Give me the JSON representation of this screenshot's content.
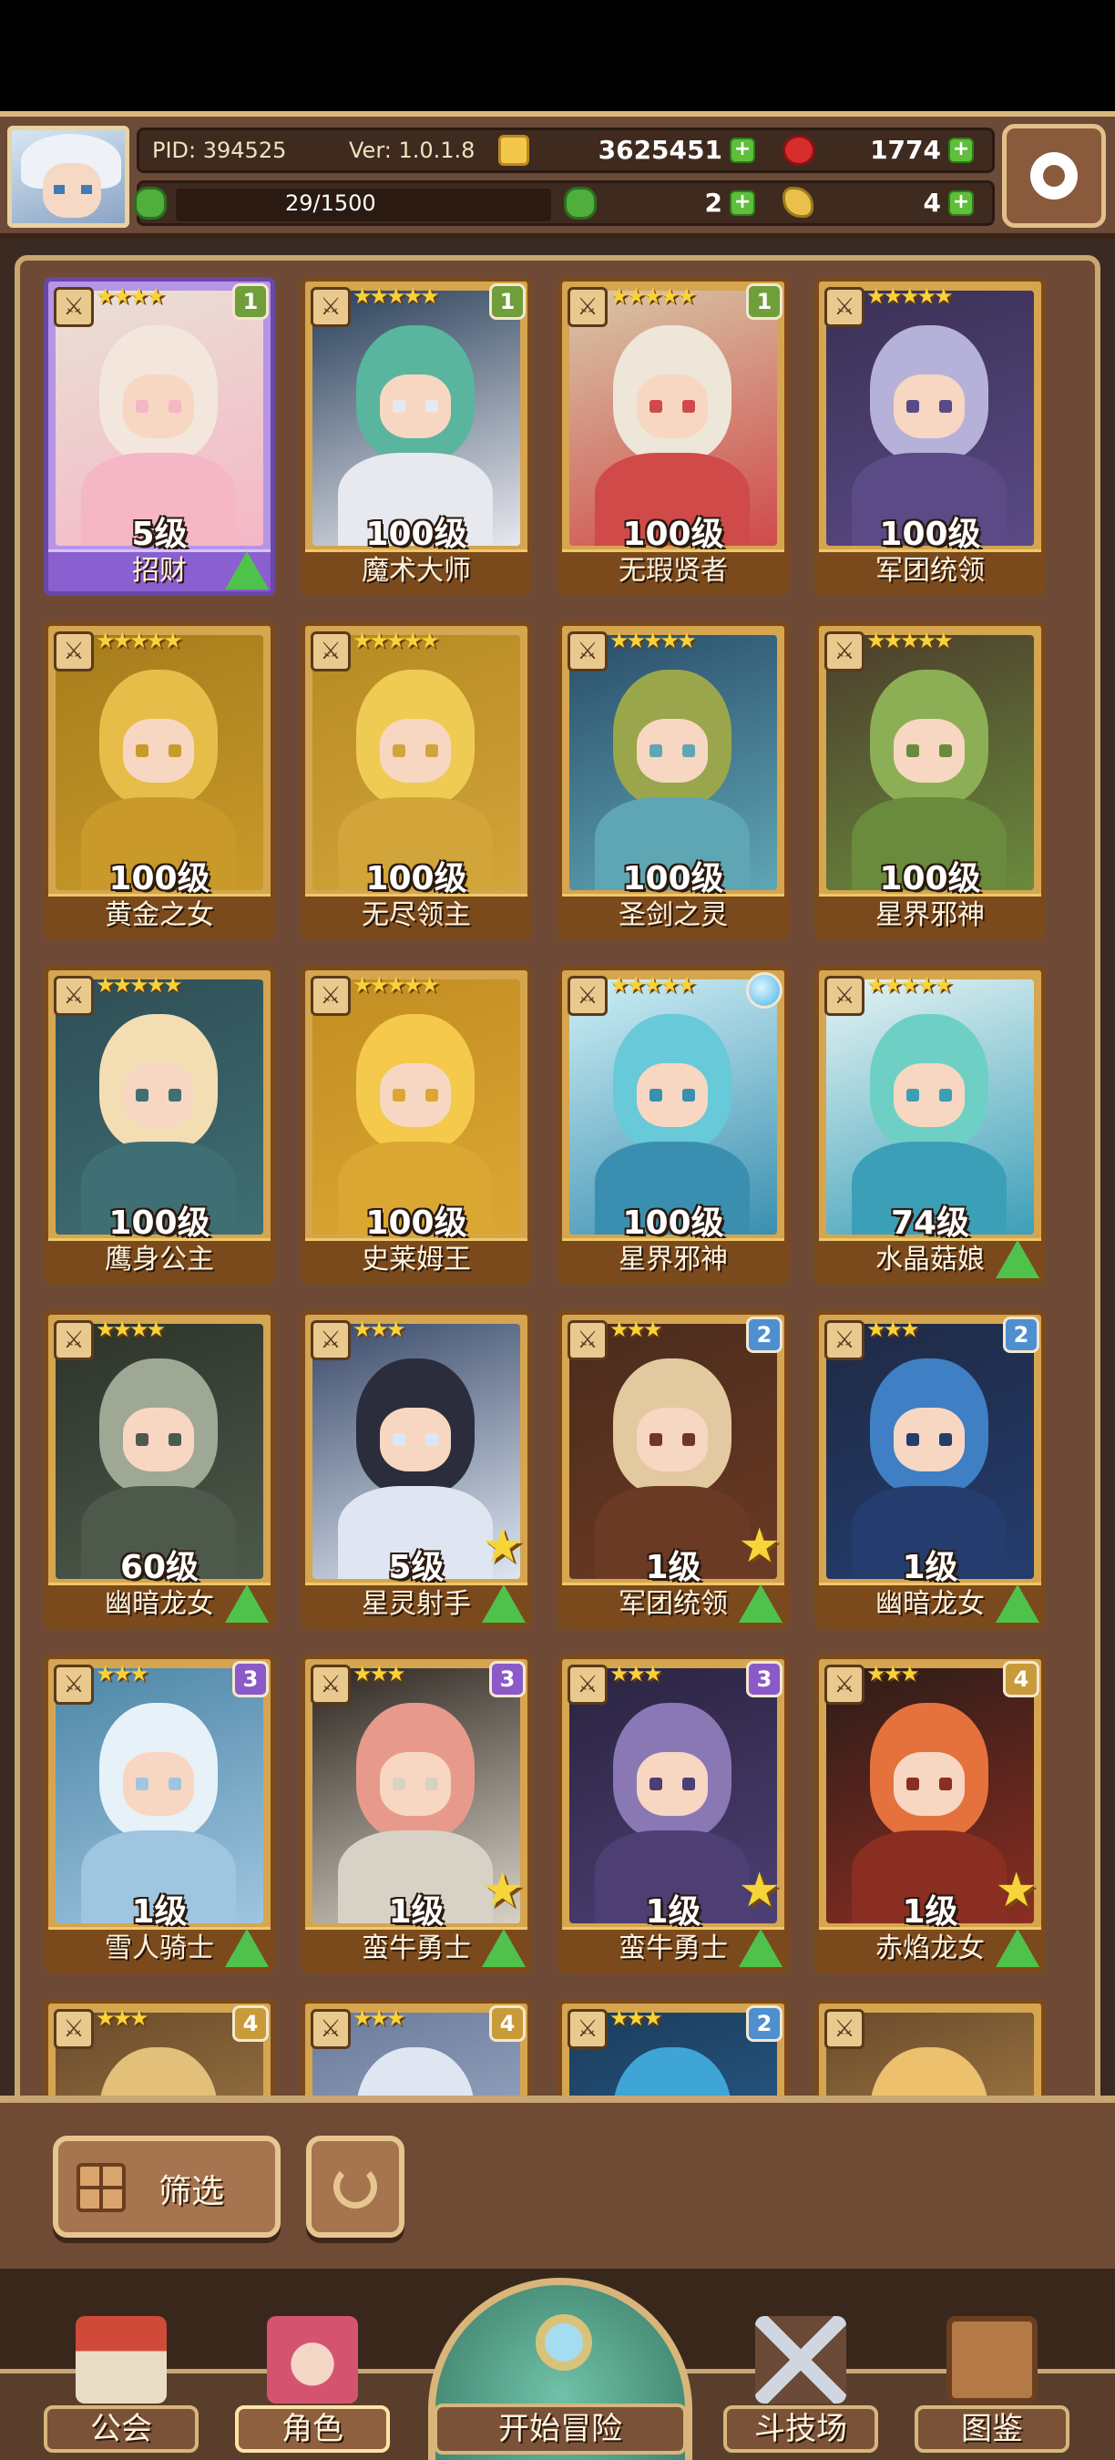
{
  "header": {
    "pid": "PID: 394525",
    "version": "Ver: 1.0.1.8",
    "gold": "3625451",
    "gems": "1774",
    "stamina": "29/1500",
    "clover": "2",
    "horn": "4"
  },
  "cards": [
    {
      "name": "招财",
      "level": "5级",
      "stars": "★★★★",
      "badge": "1",
      "badge_type": "b1",
      "purple": true,
      "up": true,
      "bigstar": false,
      "palette": [
        "#f3e6dc",
        "#f5b6c6",
        "#e9e1d6"
      ]
    },
    {
      "name": "魔术大师",
      "level": "100级",
      "stars": "★★★★★",
      "badge": "1",
      "badge_type": "b1",
      "purple": false,
      "up": false,
      "bigstar": false,
      "palette": [
        "#59b59e",
        "#e8e8ef",
        "#29405a"
      ]
    },
    {
      "name": "无瑕贤者",
      "level": "100级",
      "stars": "★★★★★",
      "badge": "1",
      "badge_type": "b1",
      "purple": false,
      "up": false,
      "bigstar": false,
      "palette": [
        "#efe6da",
        "#d04a4a",
        "#d8c8a8"
      ]
    },
    {
      "name": "军团统领",
      "level": "100级",
      "stars": "★★★★★",
      "badge": "",
      "badge_type": "",
      "purple": false,
      "up": false,
      "bigstar": false,
      "palette": [
        "#b6b1d9",
        "#5a4a86",
        "#3a3054"
      ]
    },
    {
      "name": "黄金之女",
      "level": "100级",
      "stars": "★★★★★",
      "badge": "",
      "badge_type": "",
      "purple": false,
      "up": false,
      "bigstar": false,
      "palette": [
        "#e7bd4a",
        "#c99a2a",
        "#a57c1c"
      ]
    },
    {
      "name": "无尽领主",
      "level": "100级",
      "stars": "★★★★★",
      "badge": "",
      "badge_type": "",
      "purple": false,
      "up": false,
      "bigstar": false,
      "palette": [
        "#f0cb54",
        "#d2a53a",
        "#b68a22"
      ]
    },
    {
      "name": "圣剑之灵",
      "level": "100级",
      "stars": "★★★★★",
      "badge": "",
      "badge_type": "",
      "purple": false,
      "up": false,
      "bigstar": false,
      "palette": [
        "#9aa64c",
        "#5fa6b4",
        "#2a4d6a"
      ]
    },
    {
      "name": "星界邪神",
      "level": "100级",
      "stars": "★★★★★",
      "badge": "",
      "badge_type": "",
      "purple": false,
      "up": false,
      "bigstar": false,
      "palette": [
        "#8cae55",
        "#6a8a3d",
        "#4c3d2c"
      ]
    },
    {
      "name": "鹰身公主",
      "level": "100级",
      "stars": "★★★★★",
      "badge": "",
      "badge_type": "",
      "purple": false,
      "up": false,
      "bigstar": false,
      "palette": [
        "#f3deb4",
        "#3f6f74",
        "#2f4d55"
      ]
    },
    {
      "name": "史莱姆王",
      "level": "100级",
      "stars": "★★★★★",
      "badge": "",
      "badge_type": "",
      "purple": false,
      "up": false,
      "bigstar": false,
      "palette": [
        "#f4c94c",
        "#dba733",
        "#c28d22"
      ]
    },
    {
      "name": "星界邪神",
      "level": "100级",
      "stars": "★★★★★",
      "badge": "",
      "badge_type": "orb",
      "purple": false,
      "up": false,
      "bigstar": false,
      "palette": [
        "#68c9d9",
        "#3a8fb0",
        "#cfeff6"
      ]
    },
    {
      "name": "水晶菇娘",
      "level": "74级",
      "stars": "★★★★★",
      "badge": "",
      "badge_type": "",
      "purple": false,
      "up": true,
      "bigstar": false,
      "palette": [
        "#6ed0c4",
        "#3c9fb8",
        "#e6f4f4"
      ]
    },
    {
      "name": "幽暗龙女",
      "level": "60级",
      "stars": "★★★★",
      "badge": "",
      "badge_type": "",
      "purple": false,
      "up": true,
      "bigstar": false,
      "palette": [
        "#9ea894",
        "#4d5a4b",
        "#2d3329"
      ]
    },
    {
      "name": "星灵射手",
      "level": "5级",
      "stars": "★★★",
      "badge": "",
      "badge_type": "",
      "purple": false,
      "up": true,
      "bigstar": true,
      "palette": [
        "#2b2d3c",
        "#dfe6f1",
        "#3a4a6a"
      ]
    },
    {
      "name": "军团统领",
      "level": "1级",
      "stars": "★★★",
      "badge": "2",
      "badge_type": "b2",
      "purple": false,
      "up": true,
      "bigstar": true,
      "palette": [
        "#e3c9a0",
        "#6a3a24",
        "#4b2b1c"
      ]
    },
    {
      "name": "幽暗龙女",
      "level": "1级",
      "stars": "★★★",
      "badge": "2",
      "badge_type": "b2",
      "purple": false,
      "up": true,
      "bigstar": false,
      "palette": [
        "#3f7fc4",
        "#243c6e",
        "#1f2a44"
      ]
    },
    {
      "name": "雪人骑士",
      "level": "1级",
      "stars": "★★★",
      "badge": "3",
      "badge_type": "b3",
      "purple": false,
      "up": true,
      "bigstar": false,
      "palette": [
        "#e7f1f8",
        "#9fc5e0",
        "#4d86a6"
      ]
    },
    {
      "name": "蛮牛勇士",
      "level": "1级",
      "stars": "★★★",
      "badge": "3",
      "badge_type": "b3",
      "purple": false,
      "up": true,
      "bigstar": true,
      "palette": [
        "#e79a8c",
        "#d8d2c6",
        "#2d2620"
      ]
    },
    {
      "name": "蛮牛勇士",
      "level": "1级",
      "stars": "★★★",
      "badge": "3",
      "badge_type": "b3",
      "purple": false,
      "up": true,
      "bigstar": true,
      "palette": [
        "#8a78b4",
        "#4d3f74",
        "#2a2440"
      ]
    },
    {
      "name": "赤焰龙女",
      "level": "1级",
      "stars": "★★★",
      "badge": "4",
      "badge_type": "b4",
      "purple": false,
      "up": true,
      "bigstar": true,
      "palette": [
        "#e5723c",
        "#8a2e22",
        "#2c1c18"
      ]
    },
    {
      "name": "",
      "level": "",
      "stars": "★★★",
      "badge": "4",
      "badge_type": "b4",
      "purple": false,
      "up": false,
      "bigstar": false,
      "palette": [
        "#e2c07a",
        "#b48e4e",
        "#6a4a2c"
      ]
    },
    {
      "name": "",
      "level": "",
      "stars": "★★★",
      "badge": "4",
      "badge_type": "b4",
      "purple": false,
      "up": false,
      "bigstar": false,
      "palette": [
        "#dfe6f2",
        "#b2bfd6",
        "#6a7a9a"
      ]
    },
    {
      "name": "",
      "level": "",
      "stars": "★★★",
      "badge": "2",
      "badge_type": "b2",
      "purple": false,
      "up": false,
      "bigstar": false,
      "palette": [
        "#3fa5d6",
        "#2c6aa0",
        "#1c3c5a"
      ]
    },
    {
      "name": "",
      "level": "",
      "stars": "",
      "badge": "",
      "badge_type": "",
      "purple": false,
      "up": false,
      "bigstar": false,
      "palette": [
        "#edc06e",
        "#c29650",
        "#6a4a2c"
      ]
    }
  ],
  "filter": {
    "label": "筛选"
  },
  "nav": {
    "guild": "公会",
    "character": "角色",
    "start": "开始冒险",
    "arena": "斗技场",
    "codex": "图鉴"
  },
  "icons": [
    "gold-coin-icon",
    "red-gem-icon",
    "clover-icon",
    "horn-icon",
    "settings-gear-icon",
    "filter-grid-icon",
    "refresh-icon",
    "guild-house-icon",
    "character-icon",
    "magnifier-icon",
    "crossed-swords-icon",
    "codex-book-icon"
  ]
}
